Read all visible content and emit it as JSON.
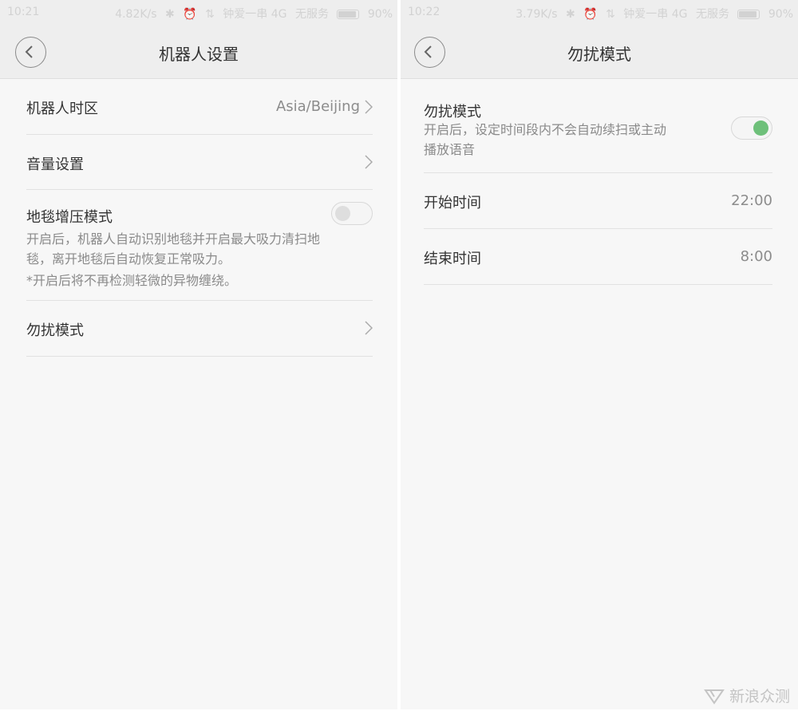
{
  "left": {
    "status": {
      "time": "10:21",
      "speed": "4.82K/s",
      "carrier": "钟爱一串 4G",
      "no_service": "无服务",
      "battery": "90%"
    },
    "title": "机器人设置",
    "rows": {
      "timezone": {
        "label": "机器人时区",
        "value": "Asia/Beijing"
      },
      "volume": {
        "label": "音量设置"
      },
      "carpet": {
        "label": "地毯增压模式",
        "desc_line1": "开启后，机器人自动识别地毯并开启最大吸力清扫地",
        "desc_line2": "毯，离开地毯后自动恢复正常吸力。",
        "note": "*开启后将不再检测轻微的异物缠绕。",
        "toggle_on": false
      },
      "dnd": {
        "label": "勿扰模式"
      }
    }
  },
  "right": {
    "status": {
      "time": "10:22",
      "speed": "3.79K/s",
      "carrier": "钟爱一串 4G",
      "no_service": "无服务",
      "battery": "90%"
    },
    "title": "勿扰模式",
    "rows": {
      "dnd": {
        "label": "勿扰模式",
        "desc_line1": "开启后，设定时间段内不会自动续扫或主动",
        "desc_line2": "播放语音",
        "toggle_on": true
      },
      "start": {
        "label": "开始时间",
        "value": "22:00"
      },
      "end": {
        "label": "结束时间",
        "value": "8:00"
      }
    }
  },
  "watermark": "新浪众测",
  "colors": {
    "toggle_on": "#6ec07a",
    "background": "#f7f7f7",
    "header": "#eeeeee"
  },
  "icons": {
    "back": "chevron-left-icon",
    "row_arrow": "chevron-right-icon"
  }
}
